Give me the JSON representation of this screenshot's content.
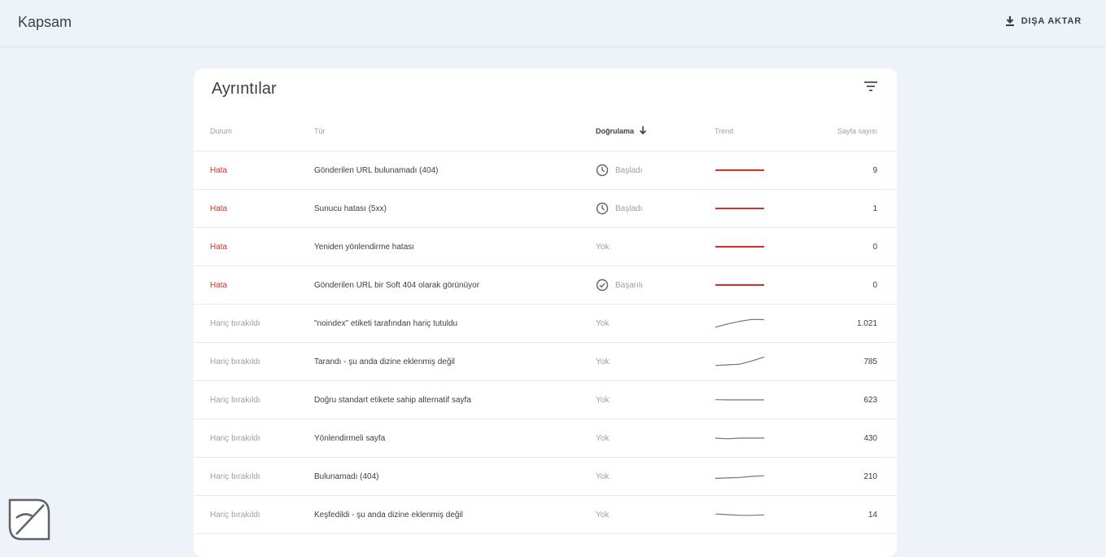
{
  "app": {
    "title": "Kapsam",
    "export_label": "DIŞA AKTAR"
  },
  "card": {
    "title": "Ayrıntılar"
  },
  "table": {
    "headers": {
      "status": "Durum",
      "type": "Tür",
      "validation": "Doğrulama",
      "trend": "Trend",
      "count": "Sayfa sayısı"
    },
    "rows": [
      {
        "status": "Hata",
        "kind": "error",
        "type": "Gönderilen URL bulunamadı (404)",
        "validation": "Başladı",
        "validation_icon": "clock-icon",
        "count": "9",
        "trend": [
          0.5,
          0.5
        ]
      },
      {
        "status": "Hata",
        "kind": "error",
        "type": "Sunucu hatası (5xx)",
        "validation": "Başladı",
        "validation_icon": "clock-icon",
        "count": "1",
        "trend": [
          0.5,
          0.5
        ]
      },
      {
        "status": "Hata",
        "kind": "error",
        "type": "Yeniden yönlendirme hatası",
        "validation": "Yok",
        "validation_icon": "",
        "count": "0",
        "trend": [
          0.5,
          0.5
        ]
      },
      {
        "status": "Hata",
        "kind": "error",
        "type": "Gönderilen URL bir Soft 404 olarak görünüyor",
        "validation": "Başarılı",
        "validation_icon": "check-circle-icon",
        "count": "0",
        "trend": [
          0.5,
          0.5
        ]
      },
      {
        "status": "Hariç bırakıldı",
        "kind": "excluded",
        "type": "\"noindex\" etiketi tarafından hariç tutuldu",
        "validation": "Yok",
        "validation_icon": "",
        "count": "1.021",
        "trend": [
          0.2,
          0.45,
          0.65,
          0.8,
          0.78
        ]
      },
      {
        "status": "Hariç bırakıldı",
        "kind": "excluded",
        "type": "Tarandı - şu anda dizine eklenmiş değil",
        "validation": "Yok",
        "validation_icon": "",
        "count": "785",
        "trend": [
          0.2,
          0.25,
          0.3,
          0.55,
          0.85
        ]
      },
      {
        "status": "Hariç bırakıldı",
        "kind": "excluded",
        "type": "Doğru standart etikete sahip alternatif sayfa",
        "validation": "Yok",
        "validation_icon": "",
        "count": "623",
        "trend": [
          0.52,
          0.5,
          0.5,
          0.5,
          0.5
        ]
      },
      {
        "status": "Hariç bırakıldı",
        "kind": "excluded",
        "type": "Yönlendirmeli sayfa",
        "validation": "Yok",
        "validation_icon": "",
        "count": "430",
        "trend": [
          0.5,
          0.45,
          0.5,
          0.5,
          0.5
        ]
      },
      {
        "status": "Hariç bırakıldı",
        "kind": "excluded",
        "type": "Bulunamadı (404)",
        "validation": "Yok",
        "validation_icon": "",
        "count": "210",
        "trend": [
          0.35,
          0.38,
          0.42,
          0.5,
          0.55
        ]
      },
      {
        "status": "Hariç bırakıldı",
        "kind": "excluded",
        "type": "Keşfedildi - şu anda dizine eklenmiş değil",
        "validation": "Yok",
        "validation_icon": "",
        "count": "14",
        "trend": [
          0.55,
          0.5,
          0.45,
          0.45,
          0.48
        ]
      }
    ]
  },
  "colors": {
    "error": "#d93025",
    "excluded_trend": "#70757a",
    "background": "#eef2f9"
  }
}
